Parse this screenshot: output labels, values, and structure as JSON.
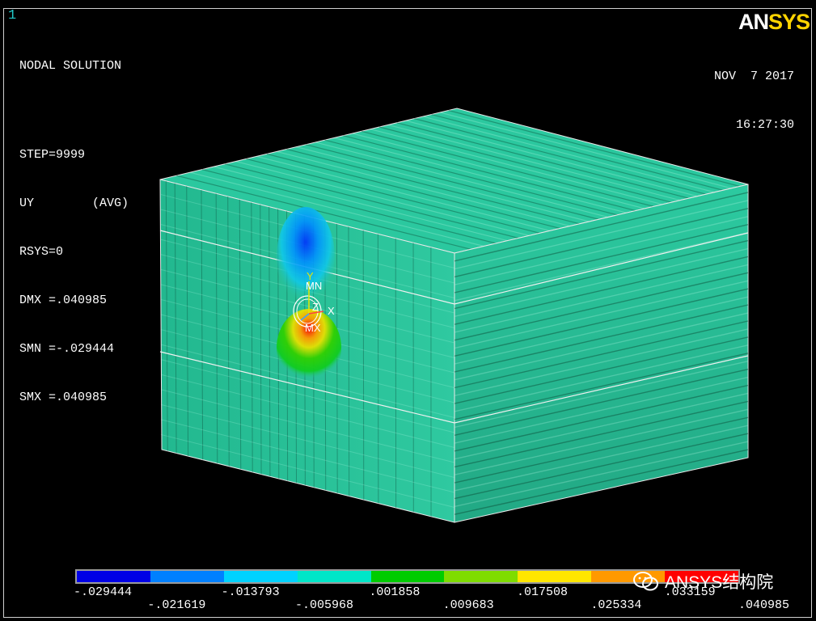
{
  "window_number": "1",
  "info": {
    "title": "NODAL SOLUTION",
    "step": "STEP=9999",
    "item": "UY        (AVG)",
    "rsys": "RSYS=0",
    "dmx": "DMX =.040985",
    "smn": "SMN =-.029444",
    "smx": "SMX =.040985"
  },
  "logo": {
    "part1": "AN",
    "part2": "SYS"
  },
  "date": "NOV  7 2017",
  "time": "16:27:30",
  "triad": {
    "y": "Y",
    "x": "X",
    "z": "Z",
    "mn": "MN",
    "mx": "MX"
  },
  "legend": {
    "colors": [
      "#0000e6",
      "#0080ff",
      "#00d2ff",
      "#00e6c8",
      "#00cc00",
      "#7fdc00",
      "#ffe600",
      "#ff9900",
      "#ff0000"
    ],
    "labels_top": [
      "-.029444",
      "-.013793",
      ".001858",
      ".017508",
      ".033159"
    ],
    "labels_bottom": [
      "-.021619",
      "-.005968",
      ".009683",
      ".025334",
      ".040985"
    ]
  },
  "watermark": {
    "text": "ANSYS结构院",
    "icon": "wechat-icon"
  },
  "model_colors": {
    "base": "#2ac49a",
    "side": "#27b48e",
    "top": "#30cba2"
  }
}
